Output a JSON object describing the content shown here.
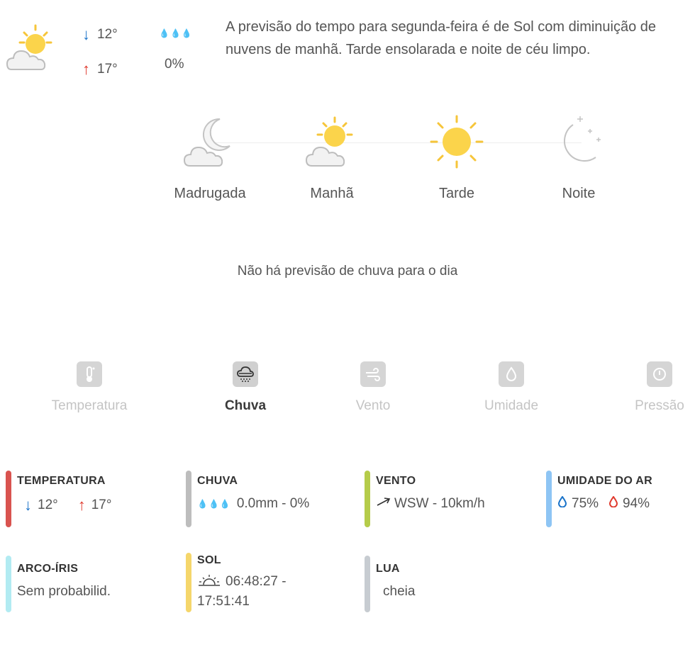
{
  "summary": {
    "min_temp": "12°",
    "max_temp": "17°",
    "precip_chance": "0%",
    "text": "A previsão do tempo para segunda-feira é de Sol com diminuição de nuvens de manhã. Tarde ensolarada e noite de céu limpo."
  },
  "periods": [
    {
      "label": "Madrugada",
      "icon": "cloud-moon-icon"
    },
    {
      "label": "Manhã",
      "icon": "sun-cloud-icon"
    },
    {
      "label": "Tarde",
      "icon": "sun-icon"
    },
    {
      "label": "Noite",
      "icon": "moon-stars-icon"
    }
  ],
  "no_rain_text": "Não há previsão de chuva para o dia",
  "tabs": [
    {
      "label": "Temperatura",
      "icon": "thermometer-icon",
      "active": false
    },
    {
      "label": "Chuva",
      "icon": "rain-cloud-icon",
      "active": true
    },
    {
      "label": "Vento",
      "icon": "wind-icon",
      "active": false
    },
    {
      "label": "Umidade",
      "icon": "droplet-icon",
      "active": false
    },
    {
      "label": "Pressão",
      "icon": "gauge-icon",
      "active": false
    }
  ],
  "stats": {
    "temperatura": {
      "title": "TEMPERATURA",
      "min": "12°",
      "max": "17°",
      "color": "#d9534f"
    },
    "chuva": {
      "title": "CHUVA",
      "value": "0.0mm - 0%",
      "color": "#bdbdbd"
    },
    "vento": {
      "title": "VENTO",
      "value": "WSW - 10km/h",
      "color": "#b5cc4a"
    },
    "umidade": {
      "title": "UMIDADE DO AR",
      "min": "75%",
      "max": "94%",
      "color": "#8ec5f4"
    },
    "arco_iris": {
      "title": "ARCO-ÍRIS",
      "value": "Sem probabilid.",
      "color": "#b2ebf2"
    },
    "sol": {
      "title": "SOL",
      "value": "06:48:27 - 17:51:41",
      "color": "#f5d66b"
    },
    "lua": {
      "title": "LUA",
      "value": "cheia",
      "color": "#c7ccd1"
    }
  },
  "colors": {
    "sun": "#fbd44b",
    "sun_rays": "#f6c53a",
    "cloud": "#f2f2f2",
    "arrow_down": "#1a73c9",
    "arrow_up": "#e03a2e"
  }
}
